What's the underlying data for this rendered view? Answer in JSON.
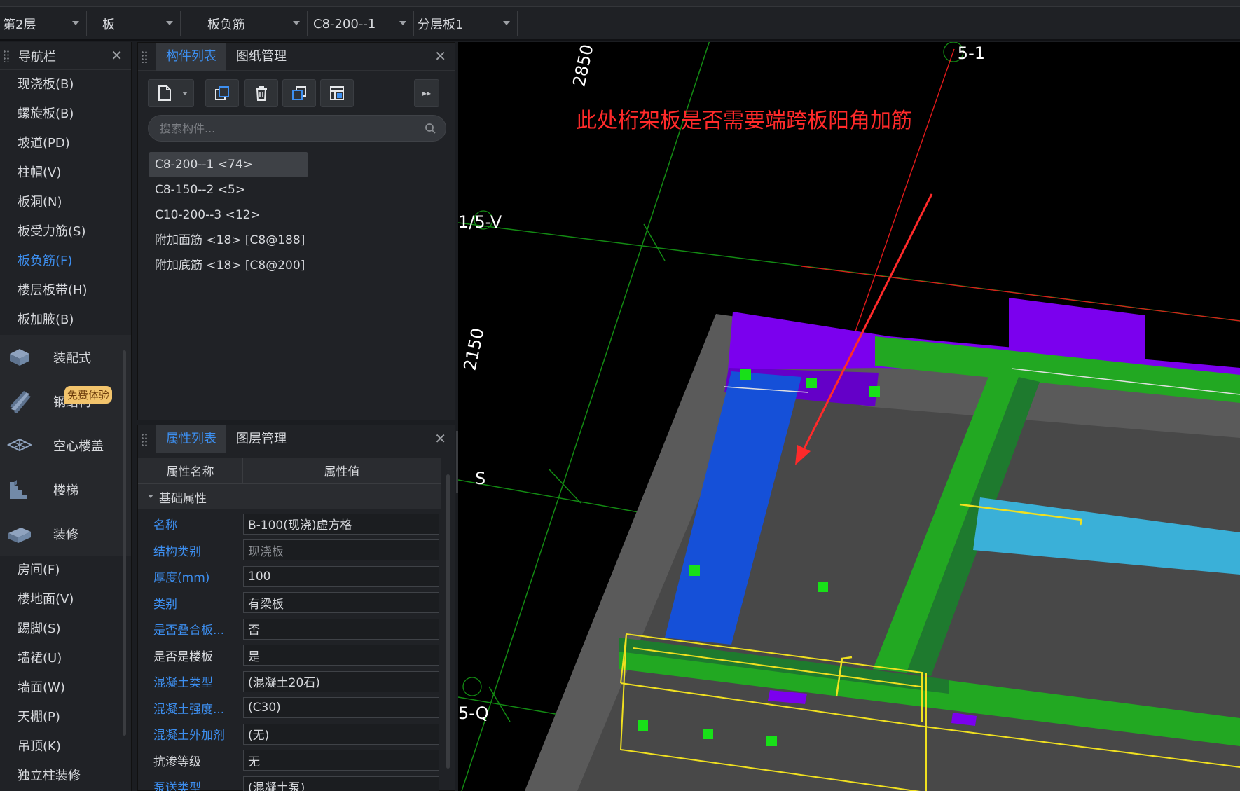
{
  "toolbar": {
    "floor": "第2层",
    "type": "板",
    "subtype": "板负筋",
    "component": "C8-200--1",
    "layer": "分层板1"
  },
  "nav": {
    "title": "导航栏",
    "items_top": [
      "现浇板(B)",
      "螺旋板(B)",
      "坡道(PD)",
      "柱帽(V)",
      "板洞(N)",
      "板受力筋(S)",
      "板负筋(F)",
      "楼层板带(H)",
      "板加腋(B)"
    ],
    "active_index": 6,
    "categories": [
      {
        "label": "装配式",
        "icon": "prefab-icon"
      },
      {
        "label": "钢结构",
        "icon": "steel-beam-icon",
        "badge": "免费体验"
      },
      {
        "label": "空心楼盖",
        "icon": "hollow-slab-icon"
      },
      {
        "label": "楼梯",
        "icon": "stairs-icon"
      },
      {
        "label": "装修",
        "icon": "decoration-icon"
      }
    ],
    "items_bottom": [
      "房间(F)",
      "楼地面(V)",
      "踢脚(S)",
      "墙裙(U)",
      "墙面(W)",
      "天棚(P)",
      "吊顶(K)",
      "独立柱装修"
    ]
  },
  "component_panel": {
    "tabs": [
      "构件列表",
      "图纸管理"
    ],
    "search_placeholder": "搜索构件...",
    "items": [
      "C8-200--1 <74>",
      "C8-150--2 <5>",
      "C10-200--3 <12>",
      "附加面筋 <18> [C8@188]",
      "附加底筋 <18> [C8@200]"
    ],
    "selected_index": 0
  },
  "property_panel": {
    "tabs": [
      "属性列表",
      "图层管理"
    ],
    "col_name": "属性名称",
    "col_value": "属性值",
    "group": "基础属性",
    "rows": [
      {
        "k": "名称",
        "v": "B-100(现浇)虚方格",
        "blue": true
      },
      {
        "k": "结构类别",
        "v": "现浇板",
        "blue": true,
        "dim": true
      },
      {
        "k": "厚度(mm)",
        "v": "100",
        "blue": true
      },
      {
        "k": "类别",
        "v": "有梁板",
        "blue": true
      },
      {
        "k": "是否叠合板...",
        "v": "否",
        "blue": true
      },
      {
        "k": "是否是楼板",
        "v": "是",
        "blue": false
      },
      {
        "k": "混凝土类型",
        "v": "(混凝土20石)",
        "blue": true
      },
      {
        "k": "混凝土强度...",
        "v": "(C30)",
        "blue": true
      },
      {
        "k": "混凝土外加剂",
        "v": "(无)",
        "blue": true
      },
      {
        "k": "抗渗等级",
        "v": "无",
        "blue": false
      },
      {
        "k": "泵送类型",
        "v": "(混凝土泵)",
        "blue": true
      }
    ]
  },
  "viewport": {
    "annotation": "此处桁架板是否需要端跨板阳角加筋",
    "labels": {
      "dim_top": "2850",
      "axis_top": "5-1",
      "axis_v": "1/5-V",
      "dim_left": "2150",
      "axis_s": "S",
      "axis_q": "5-Q"
    }
  },
  "colors": {
    "accent": "#3d8ff0",
    "annotation": "#ff2a2a",
    "wall_purple": "#7b00ee",
    "beam_green": "#22a822",
    "slab_gray": "#4a4a4a",
    "rebar_blue": "#1550d8"
  }
}
